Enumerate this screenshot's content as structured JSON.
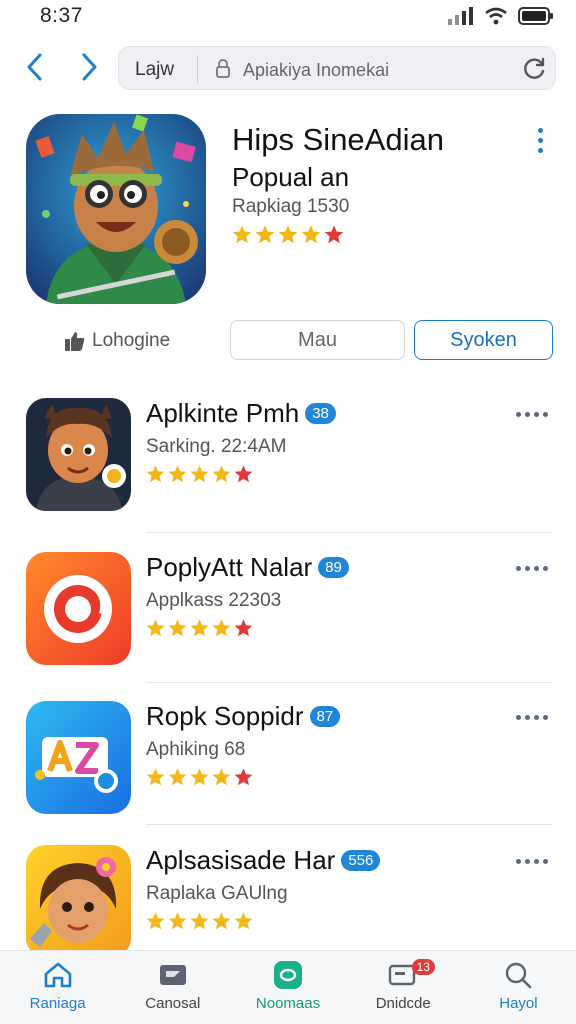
{
  "status": {
    "time": "8:37"
  },
  "browser": {
    "url_label": "Lajw",
    "url_text": "Apiakiya Inomekai",
    "icons": [
      "back-icon",
      "forward-icon",
      "lock-icon",
      "reload-icon"
    ]
  },
  "hero": {
    "title": "Hips SineAdian",
    "subtitle": "Popual an",
    "meta": "Rapkiag 1530",
    "rating": 4.5,
    "like_label": "Lohogine",
    "btn_secondary": "Mau",
    "btn_primary": "Syoken"
  },
  "apps": [
    {
      "name": "Aplkinte Pmh",
      "badge": "38",
      "meta": "Sarking. 22:4AM",
      "rating": 4.5
    },
    {
      "name": "PoplyAtt Nalar",
      "badge": "89",
      "meta": "Applkass 22303",
      "rating": 4.5
    },
    {
      "name": "Ropk Soppidr",
      "badge": "87",
      "meta": "Aphiking 68",
      "rating": 4.5
    },
    {
      "name": "Aplsasisade Har",
      "badge": "556",
      "meta": "Raplaka GAUlng",
      "rating": 5
    }
  ],
  "tabs": [
    {
      "label": "Raniaga",
      "icon": "home-icon",
      "active": true
    },
    {
      "label": "Canosal",
      "icon": "flag-icon",
      "active": false
    },
    {
      "label": "Noomaas",
      "icon": "circle-app-icon",
      "active": false
    },
    {
      "label": "Dnidcde",
      "icon": "message-icon",
      "active": false,
      "badge": "13"
    },
    {
      "label": "Hayol",
      "icon": "search-icon",
      "active": false
    }
  ],
  "colors": {
    "accent": "#1a7fd0",
    "star": "#f3b716",
    "star_red": "#e23a3a",
    "badge": "#1f86d8"
  }
}
